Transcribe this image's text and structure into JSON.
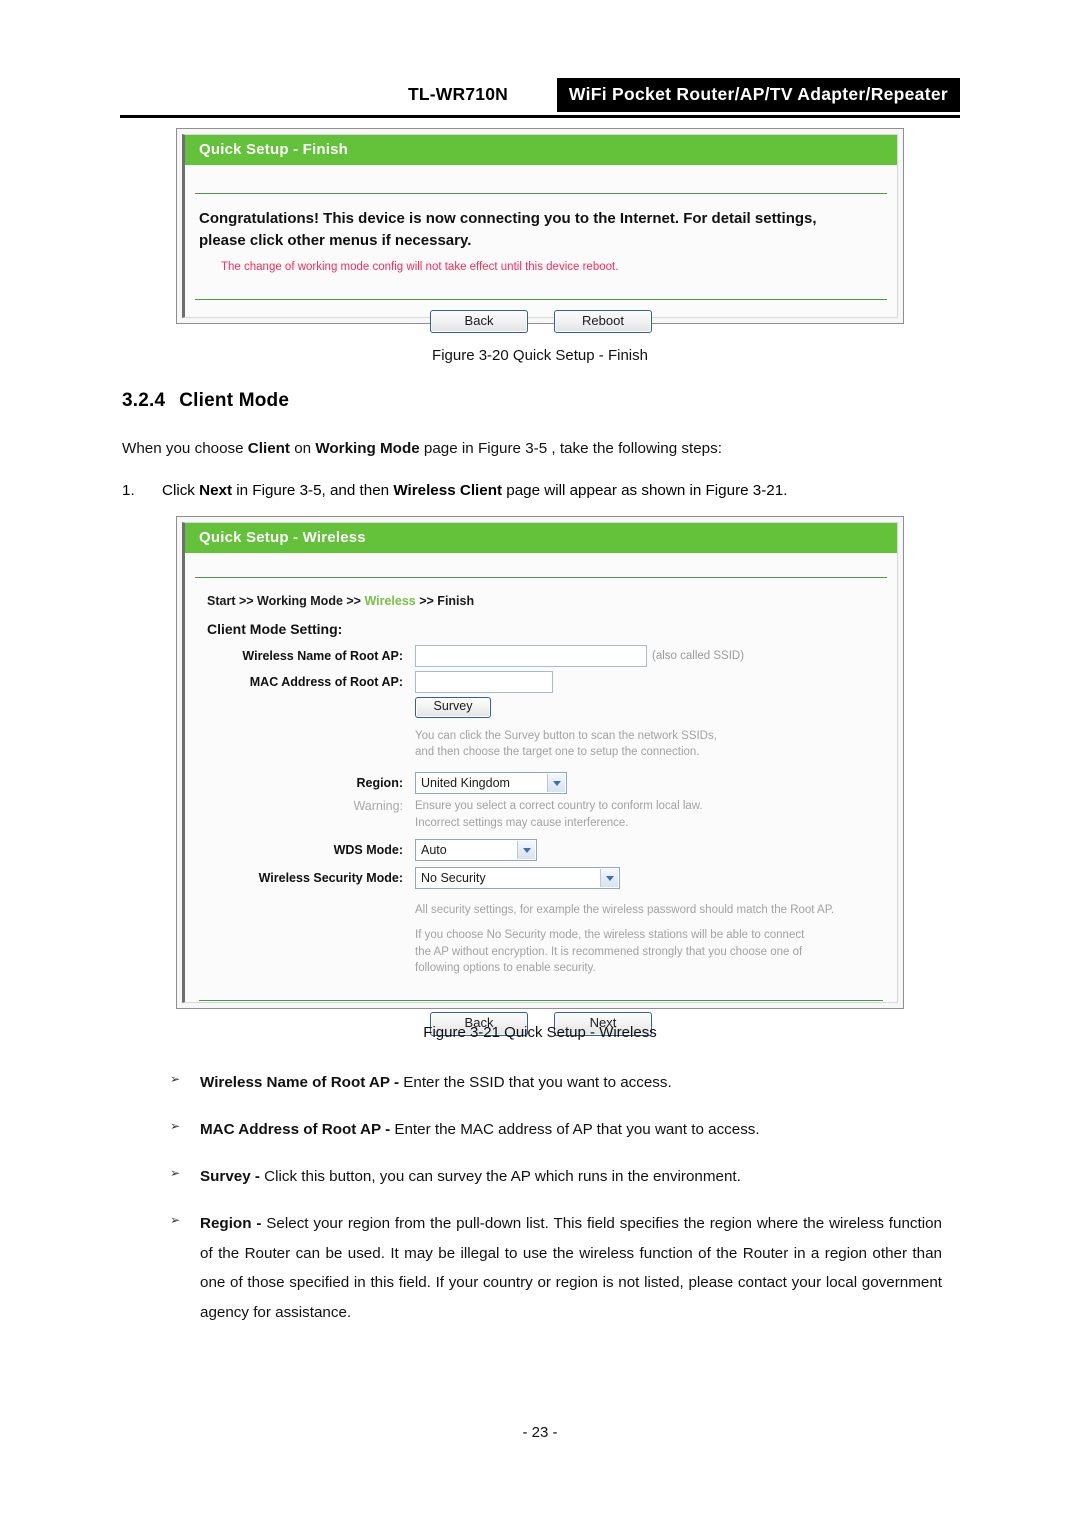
{
  "header": {
    "model": "TL-WR710N",
    "banner": "WiFi Pocket Router/AP/TV Adapter/Repeater"
  },
  "finish_panel": {
    "title": "Quick Setup - Finish",
    "message": "Congratulations! This device is now connecting you to the Internet. For detail settings, please click other menus if necessary.",
    "note": "The change of working mode config will not take effect until this device reboot.",
    "buttons": {
      "back": "Back",
      "reboot": "Reboot"
    },
    "accent_green": "#63c13a",
    "note_color": "#ff2a5a"
  },
  "figure_20_caption": "Figure 3-20 Quick Setup - Finish",
  "section": {
    "number": "3.2.4",
    "title": "Client Mode",
    "intro_pre": "When you choose ",
    "intro_b1": "Client",
    "intro_mid": " on ",
    "intro_b2": "Working Mode",
    "intro_post": " page in Figure 3-5 , take the following steps:",
    "step1_marker": "1.",
    "step1_pre": "Click ",
    "step1_b1": "Next",
    "step1_mid": " in Figure 3-5, and then ",
    "step1_b2": "Wireless Client",
    "step1_post": " page will appear as shown in Figure 3-21."
  },
  "wireless_panel": {
    "title": "Quick Setup - Wireless",
    "breadcrumb": {
      "start": "Start >> ",
      "working_mode": "Working Mode >> ",
      "current": "Wireless",
      "tail": " >> Finish"
    },
    "form_title": "Client Mode Setting:",
    "fields": {
      "ssid_label": "Wireless Name of Root AP:",
      "ssid_value": "",
      "ssid_hint": "(also called SSID)",
      "mac_label": "MAC Address of Root AP:",
      "mac_value": "",
      "survey_button": "Survey",
      "survey_help_l1": "You can click the Survey button to scan the network SSIDs,",
      "survey_help_l2": "and then choose the target one to setup the connection.",
      "region_label": "Region:",
      "region_value": "United Kingdom",
      "warning_label": "Warning:",
      "warning_l1": "Ensure you select a correct country to conform local law.",
      "warning_l2": "Incorrect settings may cause interference.",
      "wds_label": "WDS Mode:",
      "wds_value": "Auto",
      "security_label": "Wireless Security Mode:",
      "security_value": "No Security",
      "sec_help_l1": "All security settings, for example the wireless password should match the Root AP.",
      "sec_help_l2": "If you choose No Security mode, the wireless stations will be able to connect",
      "sec_help_l3": "the AP without encryption. It is recommened strongly that you choose one of",
      "sec_help_l4": "following options to enable security."
    },
    "buttons": {
      "back": "Back",
      "next": "Next"
    }
  },
  "figure_21_caption": "Figure 3-21 Quick Setup - Wireless",
  "bullets": [
    {
      "arrow": "➢",
      "term": "Wireless Name of Root AP - ",
      "desc": "Enter the SSID that you want to access."
    },
    {
      "arrow": "➢",
      "term": "MAC Address of Root AP - ",
      "desc": "Enter the MAC address of AP that you want to access."
    },
    {
      "arrow": "➢",
      "term": "Survey - ",
      "desc": "Click this button, you can survey the AP which runs in the environment."
    },
    {
      "arrow": "➢",
      "term": "Region - ",
      "desc": "Select your region from the pull-down list. This field specifies the region where the wireless function of the Router can be used. It may be illegal to use the wireless function of the Router in a region other than one of those specified in this field. If your country or region is not listed, please contact your local government agency for assistance."
    }
  ],
  "footer": {
    "page_number": "- 23 -"
  }
}
